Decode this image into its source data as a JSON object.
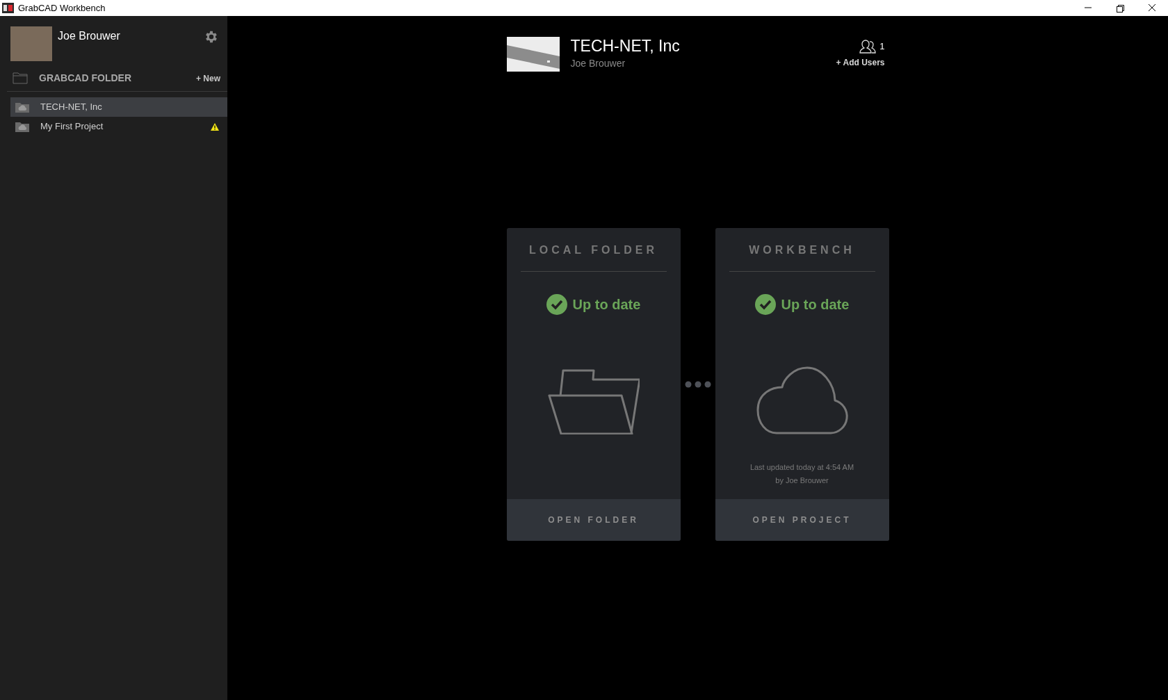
{
  "window": {
    "title": "GrabCAD Workbench"
  },
  "sidebar": {
    "user_name": "Joe Brouwer",
    "section_title": "GRABCAD FOLDER",
    "new_label": "+ New",
    "items": [
      {
        "label": "TECH-NET, Inc",
        "selected": true,
        "warning": false
      },
      {
        "label": "My First Project",
        "selected": false,
        "warning": true
      }
    ]
  },
  "header": {
    "title": "TECH-NET, Inc",
    "subtitle": "Joe Brouwer",
    "user_count": "1",
    "add_users": "+ Add Users"
  },
  "panels": [
    {
      "kind": "folder",
      "title": "LOCAL FOLDER",
      "status": "Up to date",
      "button": "OPEN FOLDER"
    },
    {
      "kind": "cloud",
      "title": "WORKBENCH",
      "status": "Up to date",
      "note": [
        "Last updated today at 4:54 AM",
        "by Joe Brouwer"
      ],
      "button": "OPEN PROJECT"
    }
  ]
}
